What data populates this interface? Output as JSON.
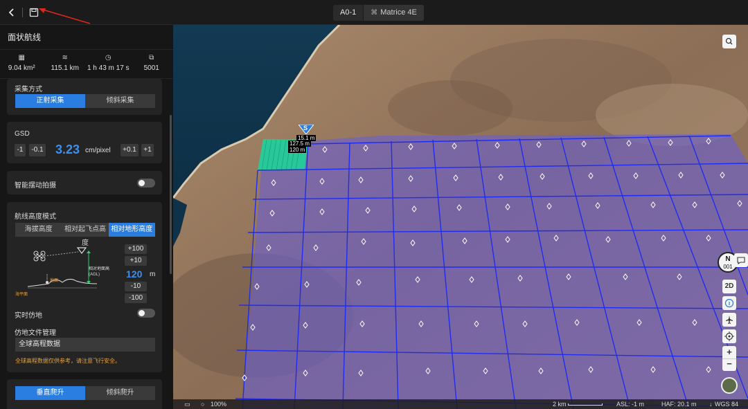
{
  "topbar": {
    "tab_route": "A0-1",
    "tab_aircraft": "Matrice 4E"
  },
  "panel": {
    "title": "面状航线",
    "stats": [
      {
        "icon": "area-icon",
        "value": "9.04 km²"
      },
      {
        "icon": "distance-icon",
        "value": "115.1 km"
      },
      {
        "icon": "clock-icon",
        "value": "1 h 43 m 17 s"
      },
      {
        "icon": "photo-count-icon",
        "value": "5001"
      }
    ],
    "capture": {
      "label": "采集方式",
      "options": [
        "正射采集",
        "倾斜采集"
      ],
      "selected": "正射采集"
    },
    "gsd": {
      "label": "GSD",
      "minus1": "-1",
      "minus01": "-0.1",
      "value": "3.23",
      "unit": "cm/pixel",
      "plus01": "+0.1",
      "plus1": "+1"
    },
    "smart_oblique": {
      "label": "智能摆动拍摄",
      "enabled": false
    },
    "altitude": {
      "label": "航线高度模式",
      "modes": [
        "海拔高度",
        "相对起飞点高度",
        "相对地形高度"
      ],
      "selected": "相对地形高度",
      "diagram_agl": "相对地面高",
      "diagram_agl_en": "(AGL)",
      "diagram_ground": "地面",
      "diagram_sea": "海平面",
      "plus100": "+100",
      "plus10": "+10",
      "value": "120",
      "unit": "m",
      "minus10": "-10",
      "minus100": "-100"
    },
    "realtime_follow": {
      "label": "实时仿地",
      "enabled": false
    },
    "terrain_file": {
      "label": "仿地文件管理",
      "value": "全球高程数据",
      "warning": "全球高程数据仅供参考，请注意飞行安全。"
    },
    "climb": {
      "options": [
        "垂直爬升",
        "倾斜爬升"
      ],
      "selected": "垂直爬升"
    }
  },
  "map": {
    "start_marker": "S",
    "start_labels": [
      "15.1 m",
      "127.5 m",
      "120 m"
    ],
    "point_label": "A",
    "controls": {
      "compass": "N",
      "compass_num": "001",
      "view_2d": "2D",
      "zoom_in": "+",
      "zoom_out": "−"
    },
    "bottom": {
      "zoom": "100%",
      "scale": "2 km",
      "asl": "ASL: -1 m",
      "haf": "HAF: 20.1 m",
      "datum": "WGS 84"
    }
  },
  "colors": {
    "accent": "#2a7de1",
    "grid_line": "#1f2cf0",
    "grid_fill": "#6a5fd0",
    "start_cell": "#1fd39a",
    "warning": "#e8a23a",
    "annotation_arrow": "#e0281f"
  }
}
